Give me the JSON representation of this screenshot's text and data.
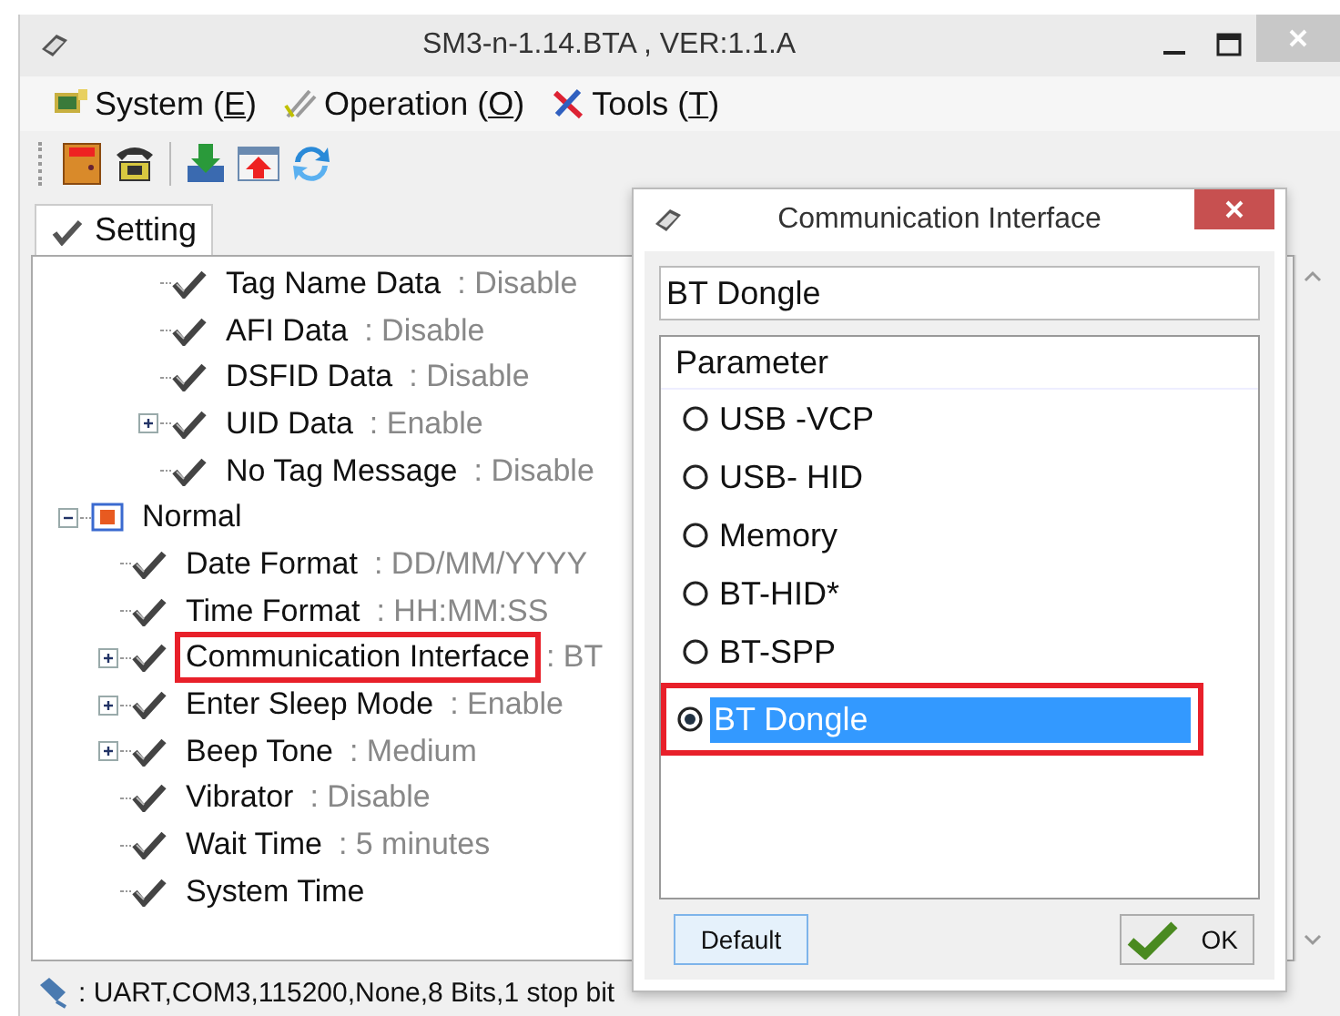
{
  "window": {
    "title": "SM3-n-1.14.BTA , VER:1.1.A"
  },
  "menu": [
    {
      "before": "System (",
      "key": "E",
      "after": ")",
      "kind": "system"
    },
    {
      "before": "Operation (",
      "key": "O",
      "after": ")",
      "kind": "operation"
    },
    {
      "before": "Tools (",
      "key": "T",
      "after": ")",
      "kind": "tools"
    }
  ],
  "toolbar": [
    {
      "kind": "exit"
    },
    {
      "kind": "phone"
    },
    {
      "kind": "separator"
    },
    {
      "kind": "download"
    },
    {
      "kind": "upload"
    },
    {
      "kind": "refresh"
    }
  ],
  "tabs": [
    {
      "label": "Setting",
      "selected": true
    }
  ],
  "tree": [
    {
      "children": [
        {
          "children": [
            {
              "kind": "setting",
              "label": "Tag Name Data",
              "value": ": Disable"
            },
            {
              "kind": "setting",
              "label": "AFI Data",
              "value": ": Disable"
            },
            {
              "kind": "setting",
              "label": "DSFID Data",
              "value": ": Disable"
            },
            {
              "kind": "setting",
              "label": "UID Data",
              "value": ": Enable",
              "expanded": false
            },
            {
              "kind": "setting",
              "label": "No Tag Message",
              "value": ": Disable"
            }
          ]
        }
      ]
    },
    {
      "kind": "group",
      "label": "Normal",
      "expanded": true,
      "children": [
        {
          "kind": "setting",
          "label": "Date Format",
          "value": ": DD/MM/YYYY"
        },
        {
          "kind": "setting",
          "label": "Time Format",
          "value": ": HH:MM:SS"
        },
        {
          "kind": "setting",
          "label": "Communication Interface",
          "value": ": BT",
          "expanded": false,
          "highlighted": true
        },
        {
          "kind": "setting",
          "label": "Enter Sleep Mode",
          "value": ": Enable",
          "expanded": false
        },
        {
          "kind": "setting",
          "label": "Beep Tone",
          "value": ": Medium",
          "expanded": false
        },
        {
          "kind": "setting",
          "label": "Vibrator",
          "value": ": Disable"
        },
        {
          "kind": "setting",
          "label": "Wait Time",
          "value": ": 5 minutes"
        },
        {
          "kind": "setting",
          "label": "System Time"
        }
      ]
    }
  ],
  "status_bar": {
    "text": ": UART,COM3,115200,None,8 Bits,1 stop bit"
  },
  "dialog": {
    "title": "Communication Interface",
    "value": "BT Dongle",
    "list_header": "Parameter",
    "options": [
      {
        "label": "USB -VCP",
        "selected": false,
        "highlighted": false
      },
      {
        "label": "USB- HID",
        "selected": false,
        "highlighted": false
      },
      {
        "label": "Memory",
        "selected": false,
        "highlighted": false
      },
      {
        "label": "BT-HID*",
        "selected": false,
        "highlighted": false
      },
      {
        "label": "BT-SPP",
        "selected": false,
        "highlighted": false
      },
      {
        "label": "BT Dongle",
        "selected": true,
        "highlighted": true
      }
    ],
    "buttons": [
      {
        "kind": "default",
        "label": "Default"
      },
      {
        "kind": "ok",
        "label": "OK"
      }
    ]
  }
}
